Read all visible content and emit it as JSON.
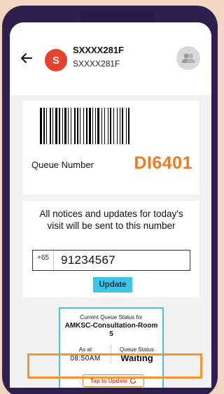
{
  "header": {
    "avatar_letter": "S",
    "title": "SXXXX281F",
    "subtitle": "SXXXX281F"
  },
  "queue": {
    "label": "Queue Number",
    "number": "DI6401"
  },
  "notice": {
    "text": "All notices and updates for today's visit will be sent to this number",
    "country_code": "+65",
    "phone_number": "91234567",
    "update_label": "Update"
  },
  "status": {
    "caption": "Current Queue Status for",
    "room": "AMKSC-Consultation-Room 5",
    "as_at_label": "As at",
    "as_at_value": "08:50AM",
    "queue_status_label": "Queue Status",
    "queue_status_value": "Waiting",
    "tap_label": "Tap to Update"
  },
  "colors": {
    "accent_orange": "#f07c1f",
    "avatar_red": "#e8412c",
    "cyan": "#3dc5e5",
    "frame": "#2f1f4e",
    "highlight": "#f7942d"
  },
  "icons": [
    "back-arrow-icon",
    "users-icon",
    "refresh-icon"
  ]
}
